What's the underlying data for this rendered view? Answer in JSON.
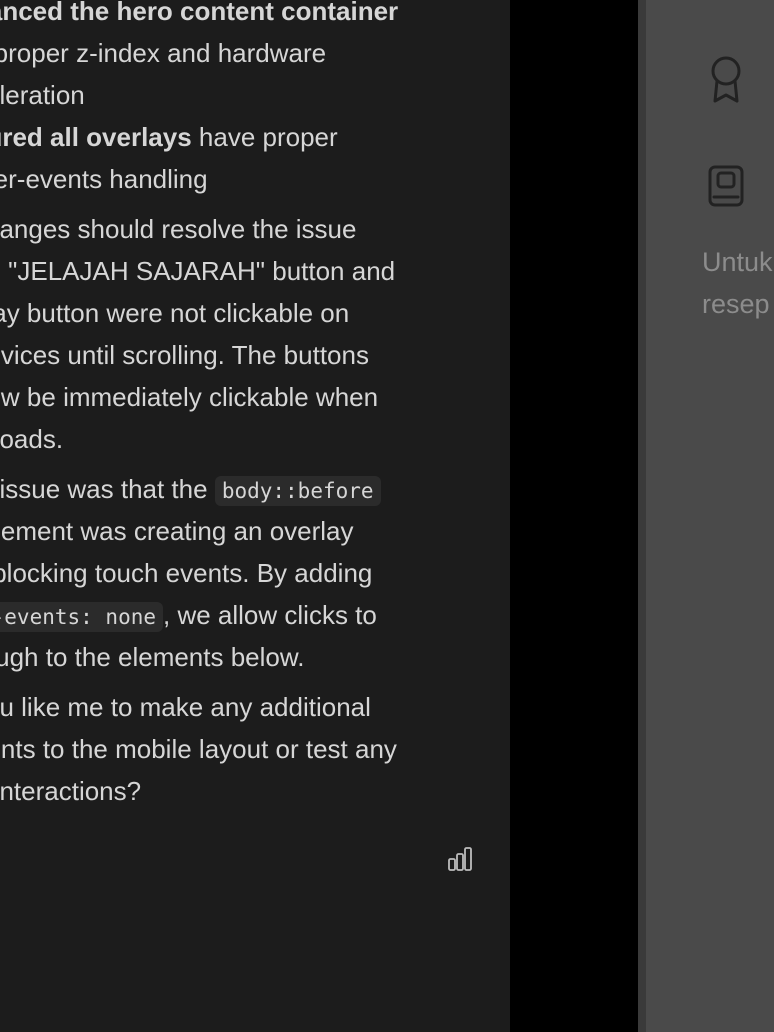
{
  "chat": {
    "lines": [
      {
        "bold": "nanced the hero content container",
        "text": ""
      },
      {
        "text": "h proper z-index and hardware"
      },
      {
        "text": "celeration"
      },
      {
        "bold": "sured all overlays",
        "text": " have proper"
      },
      {
        "text": "nter-events handling"
      },
      {
        "text": "changes should resolve the issue"
      },
      {
        "text": "he \"JELAJAH SAJARAH\" button and"
      },
      {
        "text": "play button were not clickable on"
      },
      {
        "text": "devices until scrolling. The buttons"
      },
      {
        "text": "now be immediately clickable when"
      },
      {
        "text": "e loads."
      },
      {
        "pre": "in issue was that the ",
        "code": "body::before",
        "post": ""
      },
      {
        "text": "-element was creating an overlay"
      },
      {
        "text": "s blocking touch events. By adding"
      },
      {
        "pre": "",
        "code": "r-events: none",
        "post": ", we allow clicks to"
      },
      {
        "text": "rough to the elements below."
      },
      {
        "text": "you like me to make any additional"
      },
      {
        "text": "nents to the mobile layout or test any"
      },
      {
        "text": "e interactions?"
      }
    ],
    "stats_icon": "bar-chart-icon"
  },
  "right_panel": {
    "icons": [
      "award-ribbon-icon",
      "book-icon"
    ],
    "text_line_1": "Untuk",
    "text_line_2": "resep"
  },
  "colors": {
    "chat_bg": "#1c1c1c",
    "chat_text": "#d6d6d6",
    "code_bg": "#2b2b2b",
    "gap": "#000000",
    "right_bg": "#4a4a4a",
    "right_text": "#8c8c8c"
  }
}
